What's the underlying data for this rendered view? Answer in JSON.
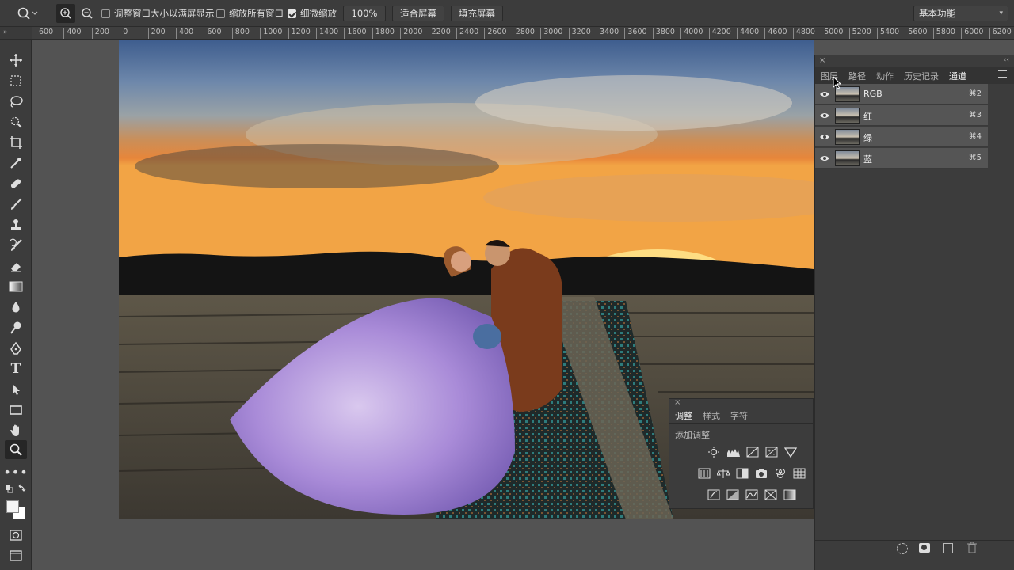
{
  "options_bar": {
    "resize_windows_label": "调整窗口大小以满屏显示",
    "zoom_all_label": "缩放所有窗口",
    "scrubby_zoom_label": "细微缩放",
    "zoom_value": "100%",
    "fit_screen_label": "适合屏幕",
    "fill_screen_label": "填充屏幕",
    "workspace_label": "基本功能",
    "resize_windows_checked": false,
    "zoom_all_checked": false,
    "scrubby_zoom_checked": true
  },
  "ruler": {
    "ticks": [
      "600",
      "400",
      "200",
      "0",
      "200",
      "400",
      "600",
      "800",
      "1000",
      "1200",
      "1400",
      "1600",
      "1800",
      "2000",
      "2200",
      "2400",
      "2600",
      "2800",
      "3000",
      "3200",
      "3400",
      "3600",
      "3800",
      "4000",
      "4200",
      "4400",
      "4600",
      "4800",
      "5000",
      "5200",
      "5400",
      "5600",
      "5800",
      "6000",
      "6200"
    ]
  },
  "channels_panel": {
    "tabs": [
      "图层",
      "路径",
      "动作",
      "历史记录",
      "通道"
    ],
    "active_tab": "通道",
    "channels": [
      {
        "name": "RGB",
        "shortcut": "⌘2"
      },
      {
        "name": "红",
        "shortcut": "⌘3"
      },
      {
        "name": "绿",
        "shortcut": "⌘4"
      },
      {
        "name": "蓝",
        "shortcut": "⌘5"
      }
    ]
  },
  "adjustments_panel": {
    "tabs": [
      "调整",
      "样式",
      "字符"
    ],
    "active_tab": "调整",
    "add_adjustment_label": "添加调整"
  },
  "colors": {
    "accent": "#e6e6e6",
    "panel_bg": "#3c3c3c",
    "canvas_bg": "#535353"
  }
}
